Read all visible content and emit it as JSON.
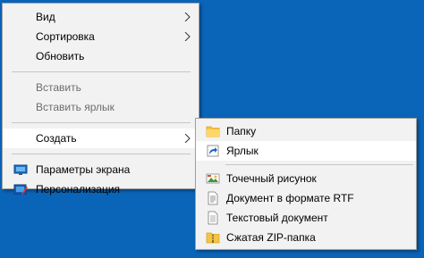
{
  "context_menu": {
    "items": [
      {
        "label": "Вид"
      },
      {
        "label": "Сортировка"
      },
      {
        "label": "Обновить"
      },
      {
        "label": "Вставить"
      },
      {
        "label": "Вставить ярлык"
      },
      {
        "label": "Создать"
      },
      {
        "label": "Параметры экрана",
        "icon": "display-settings-icon"
      },
      {
        "label": "Персонализация",
        "icon": "personalization-icon"
      }
    ]
  },
  "submenu_create": {
    "items": [
      {
        "label": "Папку",
        "icon": "folder-icon"
      },
      {
        "label": "Ярлык",
        "icon": "shortcut-icon"
      },
      {
        "label": "Точечный рисунок",
        "icon": "bitmap-image-icon"
      },
      {
        "label": "Документ в формате RTF",
        "icon": "rtf-document-icon"
      },
      {
        "label": "Текстовый документ",
        "icon": "text-document-icon"
      },
      {
        "label": "Сжатая ZIP-папка",
        "icon": "zip-folder-icon"
      }
    ]
  },
  "colors": {
    "desktop_background": "#0a64b8",
    "menu_background": "#f2f2f2",
    "highlight": "#ffffff",
    "disabled_text": "#6d6d6d"
  }
}
